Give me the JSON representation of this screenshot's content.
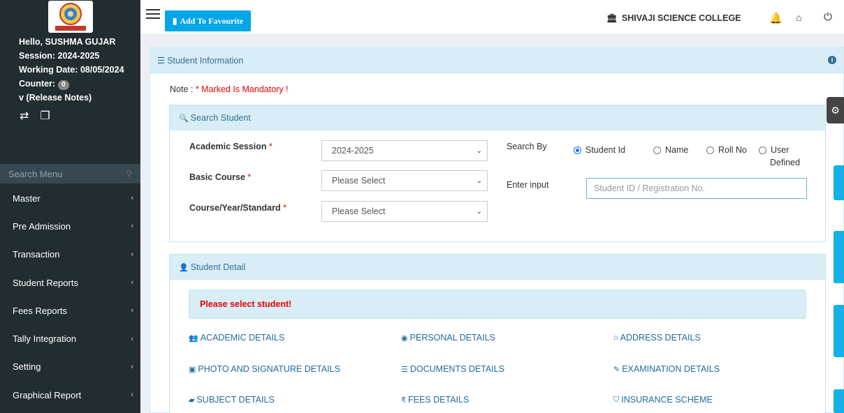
{
  "sidebar": {
    "greeting": "Hello, SUSHMA GUJAR",
    "session": "Session: 2024-2025",
    "working_date": "Working Date: 08/05/2024",
    "counter_label": "Counter:",
    "counter_value": "0",
    "release_notes": "v (Release Notes)",
    "search_placeholder": "Search Menu",
    "menu": [
      {
        "label": "Master"
      },
      {
        "label": "Pre Admission"
      },
      {
        "label": "Transaction"
      },
      {
        "label": "Student Reports"
      },
      {
        "label": "Fees Reports"
      },
      {
        "label": "Tally Integration"
      },
      {
        "label": "Setting"
      },
      {
        "label": "Graphical Report"
      }
    ]
  },
  "topbar": {
    "favourite_label": "Add To Favourite",
    "college_name": "SHIVAJI SCIENCE COLLEGE"
  },
  "main": {
    "box_title": "Student Information",
    "note_prefix": "Note : ",
    "note_mandatory": "* Marked Is Mandatory !",
    "search_panel": {
      "title": "Search Student",
      "academic_session_label": "Academic Session",
      "academic_session_value": "2024-2025",
      "basic_course_label": "Basic Course",
      "basic_course_value": "Please Select",
      "course_year_label": "Course/Year/Standard",
      "course_year_value": "Please Select",
      "required_mark": "*",
      "search_by_label": "Search By",
      "radio_options": [
        "Student Id",
        "Name",
        "Roll No",
        "User",
        "Defined"
      ],
      "selected_option": "Student Id",
      "enter_input_label": "Enter input",
      "input_placeholder": "Student ID / Registration No."
    },
    "detail_panel": {
      "title": "Student Detail",
      "alert": "Please select student!",
      "links": [
        "ACADEMIC DETAILS",
        "PERSONAL DETAILS",
        "ADDRESS DETAILS",
        "PHOTO AND SIGNATURE DETAILS",
        "DOCUMENTS DETAILS",
        "EXAMINATION DETAILS",
        "SUBJECT DETAILS",
        "FEES DETAILS",
        "INSURANCE SCHEME"
      ]
    }
  },
  "colors": {
    "sidebar_bg": "#222d32",
    "accent": "#00a6e6",
    "panel_head": "#d9edf7",
    "required": "#e60000",
    "link": "#1f6b9e"
  }
}
